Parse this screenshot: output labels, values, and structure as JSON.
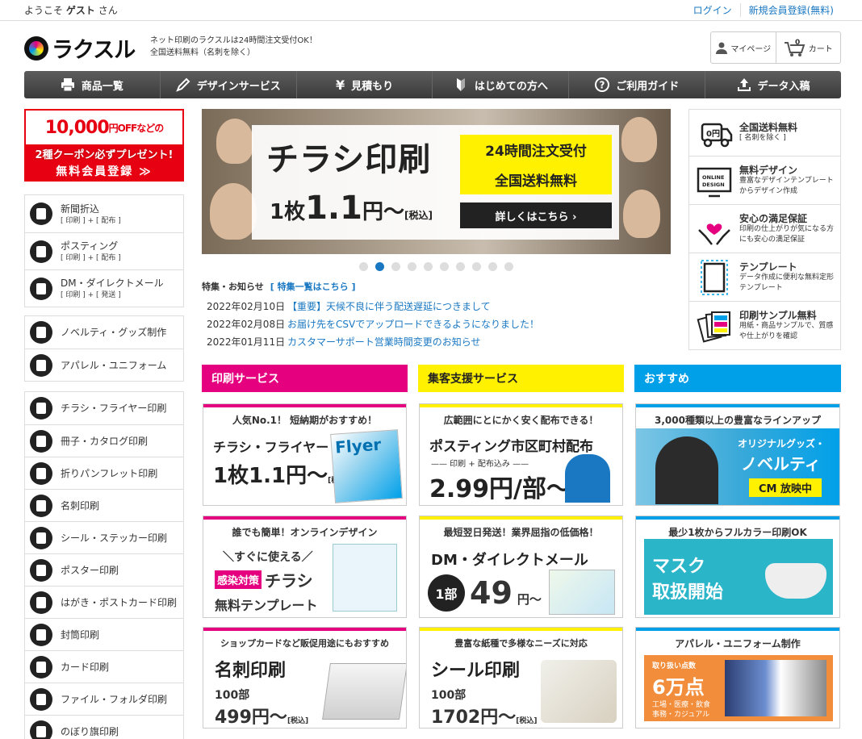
{
  "topbar": {
    "welcome_prefix": "ようこそ",
    "guest": "ゲスト",
    "welcome_suffix": "さん",
    "login": "ログイン",
    "register": "新規会員登録(無料)"
  },
  "header": {
    "logo": "ラクスル",
    "tagline1": "ネット印刷のラクスルは24時間注文受付OK！",
    "tagline2": "全国送料無料（名刺を除く）",
    "mypage": "マイページ",
    "cart": "カート",
    "cart_count": "0"
  },
  "nav": [
    "商品一覧",
    "デザインサービス",
    "見積もり",
    "はじめての方へ",
    "ご利用ガイド",
    "データ入稿"
  ],
  "coupon": {
    "amount": "10,000",
    "unit": "円OFFなどの",
    "line2": "2種クーポン必ずプレゼント!",
    "line3": "無料会員登録 ≫"
  },
  "cat1": [
    {
      "label": "新聞折込",
      "sub": "[ 印刷 ] + [ 配布 ]"
    },
    {
      "label": "ポスティング",
      "sub": "[ 印刷 ] + [ 配布 ]"
    },
    {
      "label": "DM・ダイレクトメール",
      "sub": "[ 印刷 ] + [ 発送 ]"
    }
  ],
  "cat2": [
    "ノベルティ・グッズ制作",
    "アパレル・ユニフォーム"
  ],
  "cat3": [
    "チラシ・フライヤー印刷",
    "冊子・カタログ印刷",
    "折りパンフレット印刷",
    "名刺印刷",
    "シール・ステッカー印刷",
    "ポスター印刷",
    "はがき・ポストカード印刷",
    "封筒印刷",
    "カード印刷",
    "ファイル・フォルダ印刷",
    "のぼり旗印刷"
  ],
  "hero": {
    "title": "チラシ印刷",
    "price_a": "1枚",
    "price_b": "1.1",
    "price_c": "円〜",
    "tax": "[税込]",
    "badge1": "24時間注文受付",
    "badge2": "全国送料無料",
    "cta": "詳しくはこちら ›"
  },
  "news": {
    "heading": "特集・お知らせ",
    "all_link": "[ 特集一覧はこちら ]",
    "items": [
      {
        "date": "2022年02月10日",
        "title": "【重要】天候不良に伴う配送遅延につきまして"
      },
      {
        "date": "2022年02月08日",
        "title": "お届け先をCSVでアップロードできるようになりました！"
      },
      {
        "date": "2022年01月11日",
        "title": "カスタマーサポート営業時間変更のお知らせ"
      }
    ]
  },
  "features": [
    {
      "title": "全国送料無料",
      "sub": "[ 名刺を除く ]"
    },
    {
      "title": "無料デザイン",
      "sub": "豊富なデザインテンプレートからデザイン作成"
    },
    {
      "title": "安心の満足保証",
      "sub": "印刷の仕上がりが気になる方にも安心の満足保証"
    },
    {
      "title": "テンプレート",
      "sub": "データ作成に便利な無料定形テンプレート"
    },
    {
      "title": "印刷サンプル無料",
      "sub": "用紙・商品サンプルで、質感や仕上がりを確認"
    }
  ],
  "sections": {
    "print": "印刷サービス",
    "promo": "集客支援サービス",
    "recommend": "おすすめ"
  },
  "cards": {
    "flyer": {
      "top": "人気No.1！ 短納期がおすすめ！",
      "name": "チラシ・フライヤー",
      "price": "1枚1.1円〜",
      "tax": "[税込]",
      "img": "Flyer"
    },
    "posting": {
      "top": "広範囲にとにかく安く配布できる！",
      "name": "ポスティング市区町村配布",
      "sub": "—— 印刷 + 配布込み ——",
      "price": "2.99円/部〜"
    },
    "novelty": {
      "top": "3,000種類以上の豊富なラインアップ",
      "l1": "オリジナルグッズ・",
      "l2": "ノベルティ",
      "l3": "CM 放映中"
    },
    "online": {
      "top": "誰でも簡単！オンラインデザイン",
      "l1": "＼すぐに使える／",
      "l2": "感染対策",
      "l3": "チラシ",
      "l4": "無料テンプレート"
    },
    "dm": {
      "top": "最短翌日発送！業界屈指の低価格！",
      "name": "DM・ダイレクトメール",
      "badge": "1部",
      "price": "49",
      "unit": "円〜"
    },
    "mask": {
      "top": "最少1枚からフルカラー印刷OK",
      "l1": "マスク",
      "l2": "取扱開始"
    },
    "card": {
      "top": "ショップカードなど販促用途にもおすすめ",
      "name": "名刺印刷",
      "qty": "100部",
      "price": "499円〜",
      "tax": "[税込]"
    },
    "seal": {
      "top": "豊富な紙種で多様なニーズに対応",
      "name": "シール印刷",
      "qty": "100部",
      "price": "1702円〜",
      "tax": "[税込]"
    },
    "apparel": {
      "top": "アパレル・ユニフォーム制作",
      "l1": "取り扱い点数",
      "l2": "6万点",
      "l3": "工場・医療・飲食",
      "l4": "事務・カジュアル"
    }
  }
}
